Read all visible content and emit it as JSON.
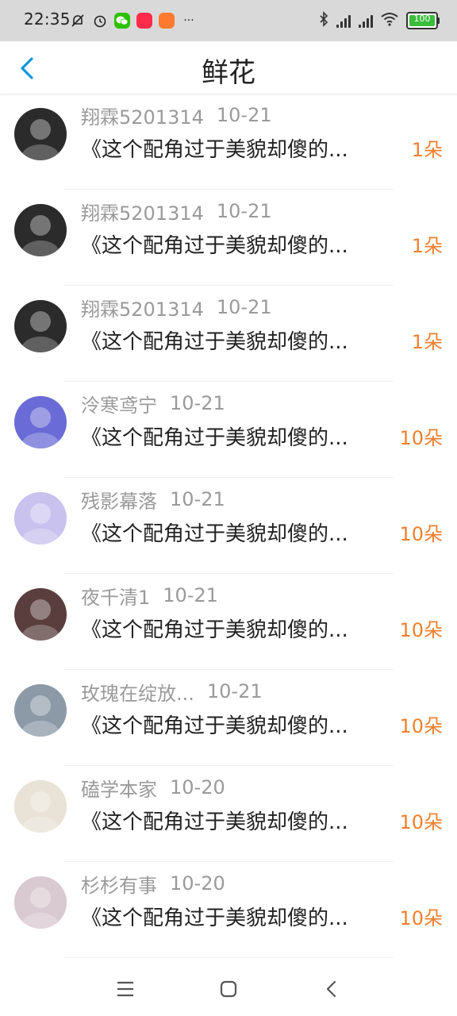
{
  "status_bar": {
    "time": "22:35",
    "more": "···",
    "battery_text": "100",
    "battery_level": 1.0,
    "icons": [
      "mute-icon",
      "alarm-icon",
      "wechat-icon",
      "app-red-icon",
      "app-orange-icon",
      "bluetooth-icon",
      "signal-icon",
      "wifi-icon",
      "battery-icon"
    ]
  },
  "header": {
    "title": "鲜花",
    "back_icon": "chevron-left-icon"
  },
  "items": [
    {
      "username": "翔霖5201314",
      "date": "10-21",
      "work": "《这个配角过于美貌却傻的...",
      "flowers": "1朵",
      "avatar_color": "#2b2b2b"
    },
    {
      "username": "翔霖5201314",
      "date": "10-21",
      "work": "《这个配角过于美貌却傻的...",
      "flowers": "1朵",
      "avatar_color": "#2b2b2b"
    },
    {
      "username": "翔霖5201314",
      "date": "10-21",
      "work": "《这个配角过于美貌却傻的...",
      "flowers": "1朵",
      "avatar_color": "#2b2b2b"
    },
    {
      "username": "泠寒鸢宁",
      "date": "10-21",
      "work": "《这个配角过于美貌却傻的...",
      "flowers": "10朵",
      "avatar_color": "#6a6bd6"
    },
    {
      "username": "残影幕落",
      "date": "10-21",
      "work": "《这个配角过于美貌却傻的...",
      "flowers": "10朵",
      "avatar_color": "#c9c2ee"
    },
    {
      "username": "夜千清1",
      "date": "10-21",
      "work": "《这个配角过于美貌却傻的...",
      "flowers": "10朵",
      "avatar_color": "#5a3e3e"
    },
    {
      "username": "玫瑰在绽放...",
      "date": "10-21",
      "work": "《这个配角过于美貌却傻的...",
      "flowers": "10朵",
      "avatar_color": "#8c9aa8"
    },
    {
      "username": "磕学本家",
      "date": "10-20",
      "work": "《这个配角过于美貌却傻的...",
      "flowers": "10朵",
      "avatar_color": "#e9e2d6"
    },
    {
      "username": "杉杉有事",
      "date": "10-20",
      "work": "《这个配角过于美貌却傻的...",
      "flowers": "10朵",
      "avatar_color": "#d9c9d0"
    }
  ],
  "nav_bar": {
    "menu_icon": "menu-icon",
    "home_icon": "home-icon",
    "back_icon": "back-icon"
  },
  "colors": {
    "accent": "#1296db",
    "flowers": "#f07f2c",
    "meta": "#9a9a9a",
    "status_bar_bg": "#d9d9d9"
  }
}
